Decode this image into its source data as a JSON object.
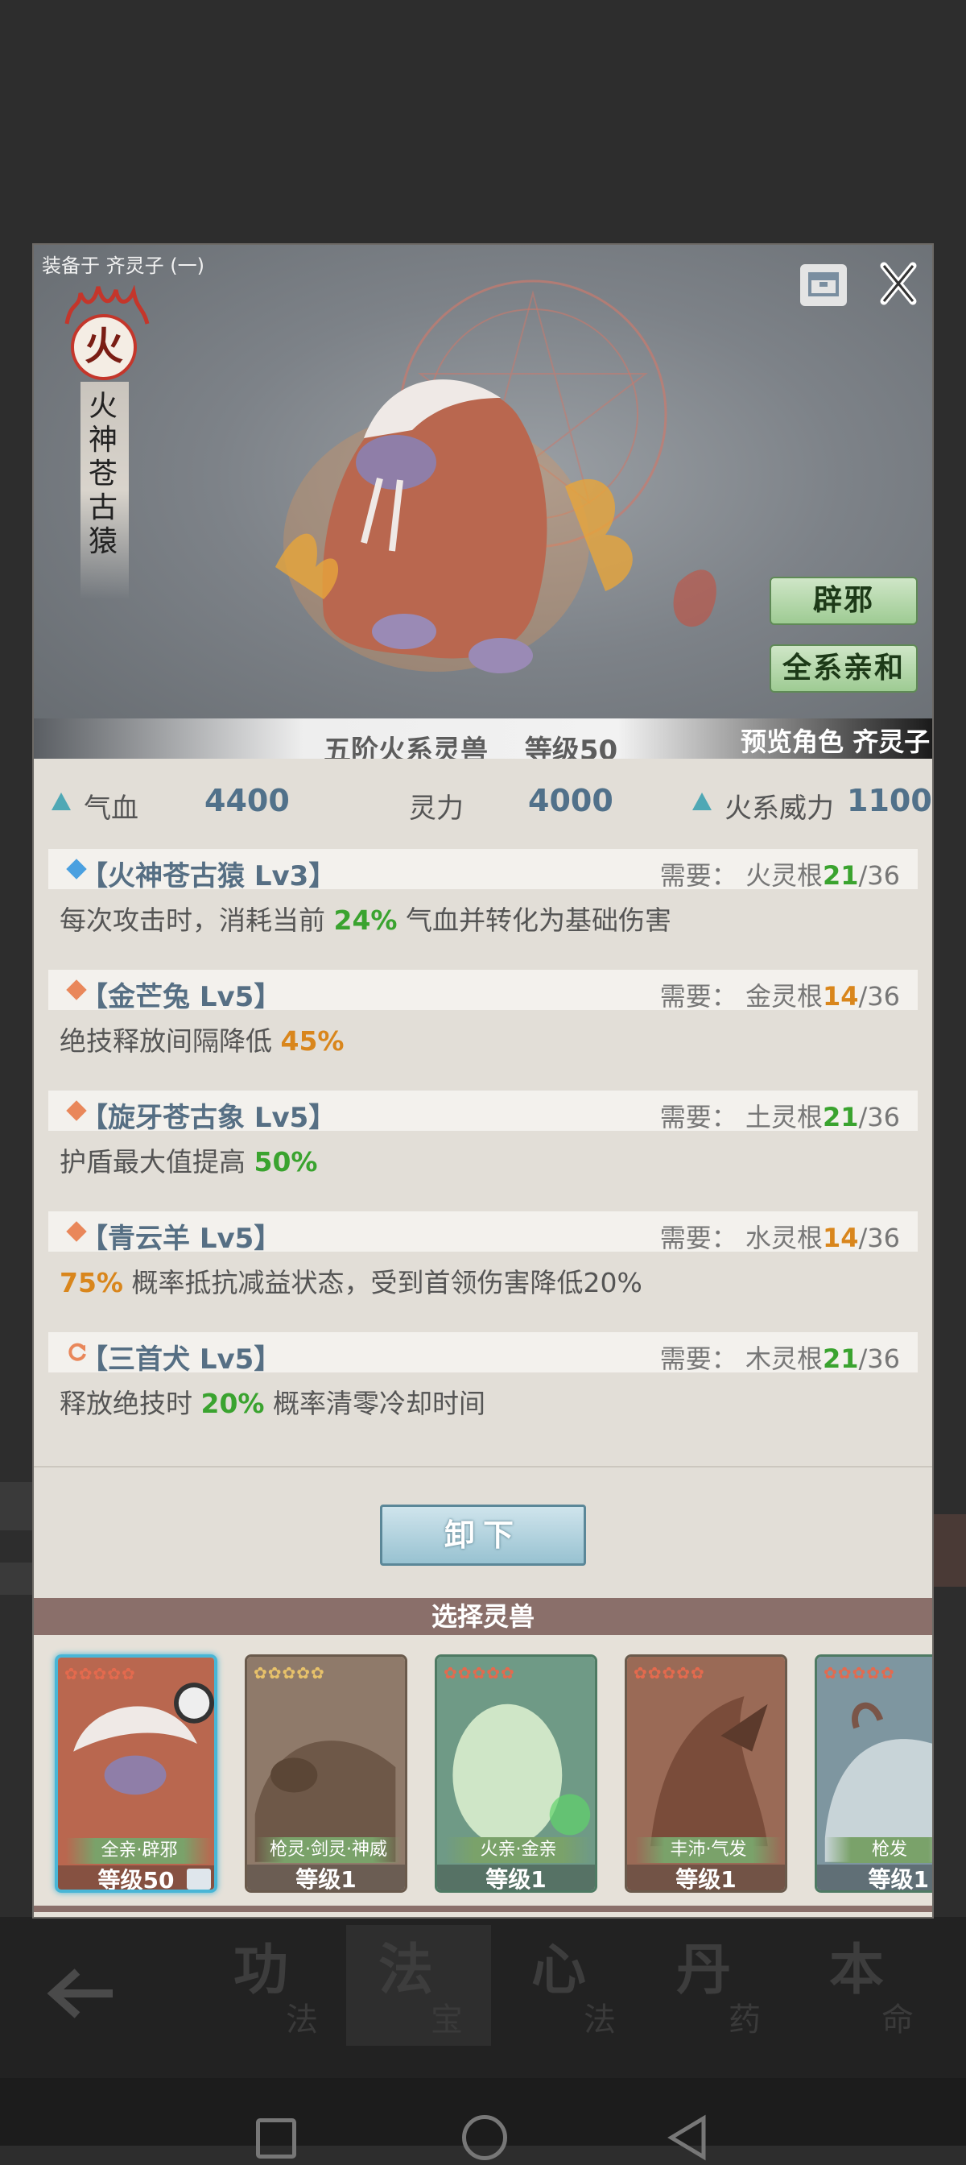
{
  "background": {
    "nav": [
      {
        "main": "功",
        "sub": "法"
      },
      {
        "main": "法",
        "sub": "宝"
      },
      {
        "main": "心",
        "sub": "法"
      },
      {
        "main": "丹",
        "sub": "药"
      },
      {
        "main": "本",
        "sub": "命"
      }
    ]
  },
  "modal": {
    "equipped_on": "装备于 齐灵子 (一)",
    "element_badge": "火",
    "beast_name": "火神苍古猿",
    "traits": [
      "辟邪",
      "全系亲和"
    ],
    "info_center": "五阶火系灵兽　 等级50",
    "preview": "预览角色 齐灵子",
    "stats": [
      {
        "label": "气血",
        "value": "4400"
      },
      {
        "label": "灵力",
        "value": "4000"
      },
      {
        "label": "火系威力",
        "value": "1100"
      }
    ],
    "skills": [
      {
        "title": "【火神苍古猿 Lv3】",
        "req_prefix": "需要：  火灵根",
        "req_cur": "21",
        "req_max": "/36",
        "desc_pre": "每次攻击时，消耗当前 ",
        "desc_hl": "24%",
        "desc_post": " 气血并转化为基础伤害",
        "icon_color": "#4aa0e0"
      },
      {
        "title": "【金芒兔 Lv5】",
        "req_prefix": "需要：  金灵根",
        "req_cur": "14",
        "req_max": "/36",
        "desc_pre": "绝技释放间隔降低 ",
        "desc_hl": "45%",
        "desc_post": "",
        "icon_color": "#e9875a"
      },
      {
        "title": "【旋牙苍古象 Lv5】",
        "req_prefix": "需要：  土灵根",
        "req_cur": "21",
        "req_max": "/36",
        "desc_pre": "护盾最大值提高 ",
        "desc_hl": "50%",
        "desc_post": "",
        "icon_color": "#e9875a"
      },
      {
        "title": "【青云羊 Lv5】",
        "req_prefix": "需要：  水灵根",
        "req_cur": "14",
        "req_max": "/36",
        "desc_pre": "",
        "desc_hl": "75%",
        "desc_post": " 概率抵抗减益状态，受到首领伤害降低20%",
        "icon_color": "#e9875a"
      },
      {
        "title": "【三首犬 Lv5】",
        "req_prefix": "需要：  木灵根",
        "req_cur": "21",
        "req_max": "/36",
        "desc_pre": "释放绝技时 ",
        "desc_hl": "20%",
        "desc_post": " 概率清零冷却时间",
        "icon_color": "#e9875a"
      }
    ],
    "unload_label": "卸下",
    "select_header": "选择灵兽",
    "cards": [
      {
        "tag": "全亲·辟邪",
        "level": "等级50",
        "selected": true
      },
      {
        "tag": "枪灵·剑灵·神威",
        "level": "等级1",
        "selected": false
      },
      {
        "tag": "火亲·金亲",
        "level": "等级1",
        "selected": false
      },
      {
        "tag": "丰沛·气发",
        "level": "等级1",
        "selected": false
      },
      {
        "tag": "枪发",
        "level": "等级1",
        "selected": false
      }
    ]
  }
}
